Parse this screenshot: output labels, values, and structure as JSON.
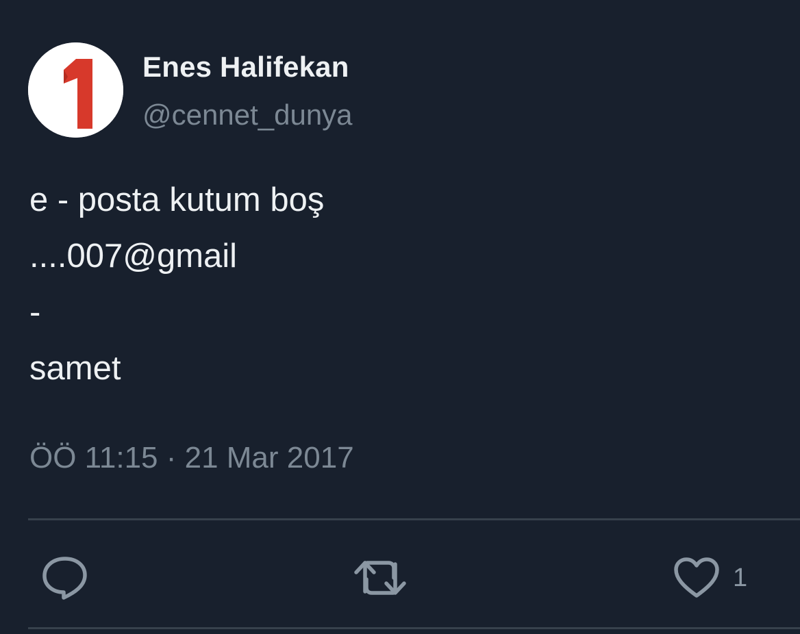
{
  "tweet": {
    "author": {
      "display_name": "Enes Halifekan",
      "handle": "@cennet_dunya",
      "avatar_icon": "number-one-avatar-icon"
    },
    "text_lines": [
      "e - posta kutum boş",
      "....007@gmail",
      "-",
      "samet"
    ],
    "timestamp": "ÖÖ 11:15 · 21 Mar 2017",
    "actions": {
      "reply_icon": "speech-bubble-icon",
      "retweet_icon": "retweet-arrows-icon",
      "like_icon": "heart-icon",
      "like_count": "1"
    }
  },
  "colors": {
    "background": "#18202d",
    "primary_text": "#eef1f3",
    "secondary_text": "#7c8894",
    "divider": "#37414c",
    "avatar_red": "#d7392b"
  }
}
